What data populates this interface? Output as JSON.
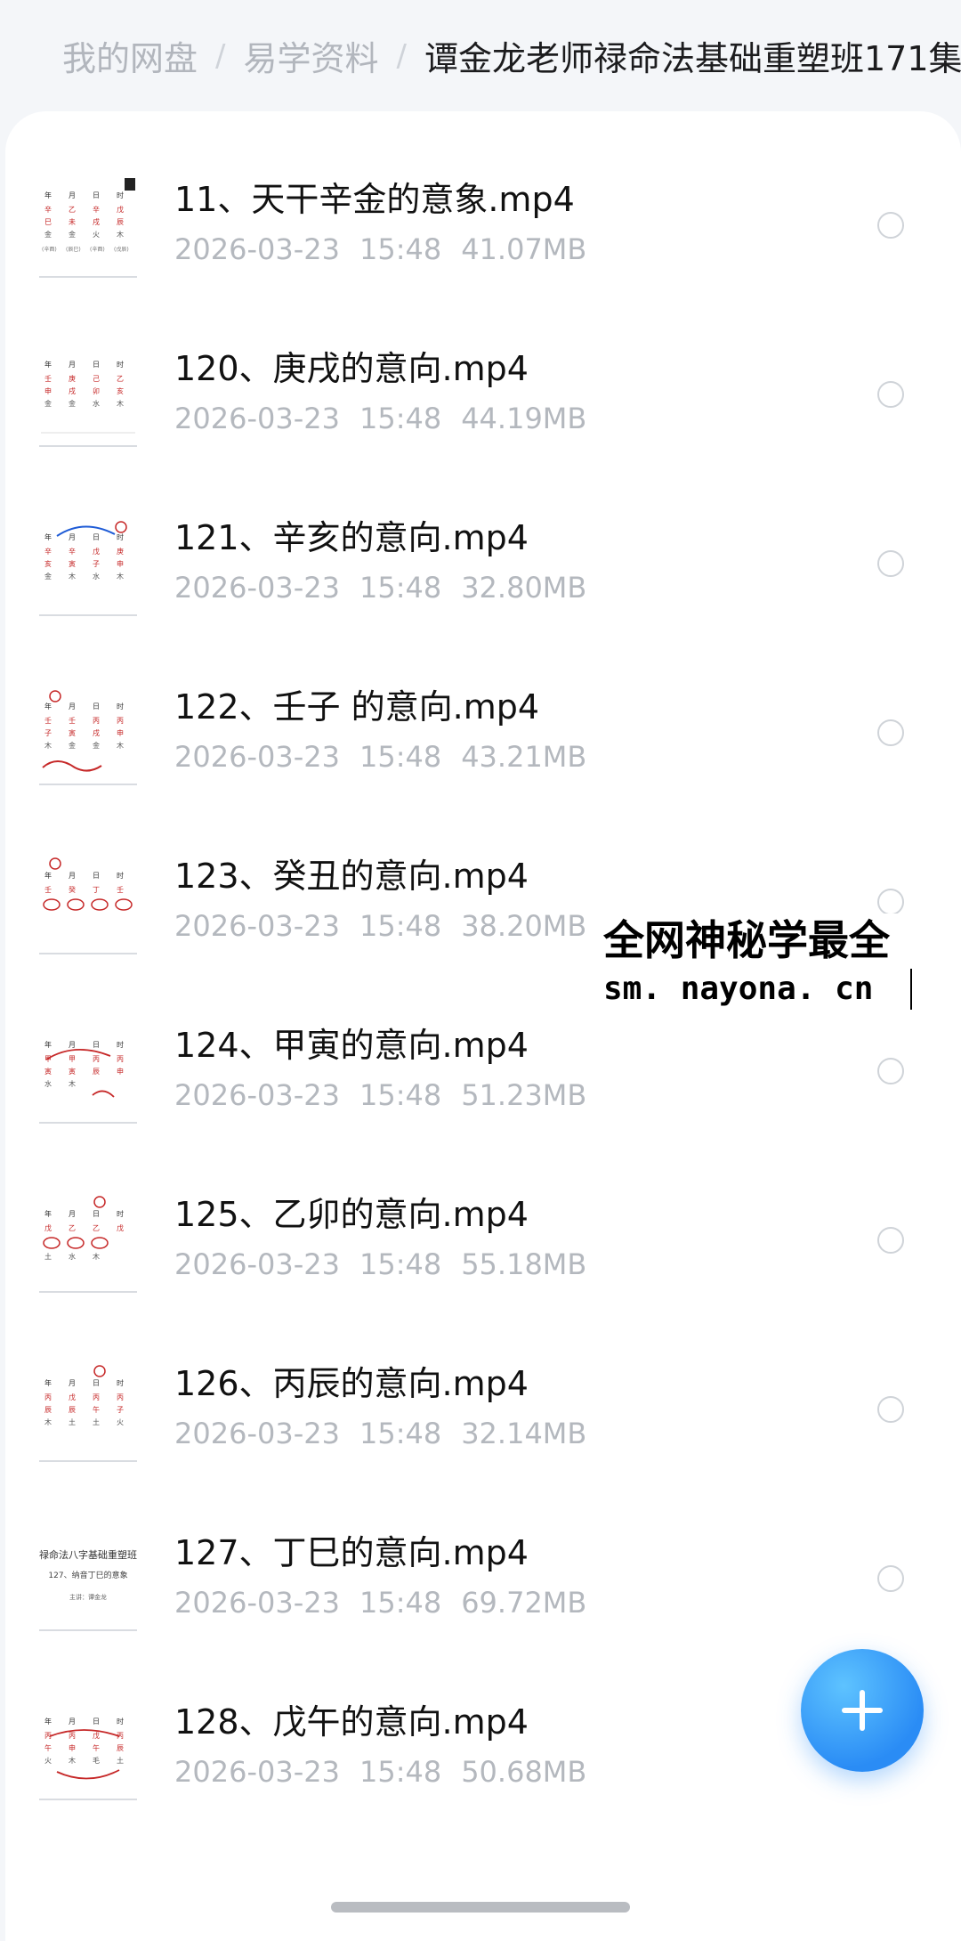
{
  "breadcrumb": {
    "items": [
      "我的网盘",
      "易学资料",
      "谭金龙老师禄命法基础重塑班171集"
    ],
    "separator": "/"
  },
  "files": [
    {
      "name": "11、天干辛金的意象.mp4",
      "date": "2026-03-23",
      "time": "15:48",
      "size": "41.07MB"
    },
    {
      "name": "120、庚戌的意向.mp4",
      "date": "2026-03-23",
      "time": "15:48",
      "size": "44.19MB"
    },
    {
      "name": "121、辛亥的意向.mp4",
      "date": "2026-03-23",
      "time": "15:48",
      "size": "32.80MB"
    },
    {
      "name": "122、壬子 的意向.mp4",
      "date": "2026-03-23",
      "time": "15:48",
      "size": "43.21MB"
    },
    {
      "name": "123、癸丑的意向.mp4",
      "date": "2026-03-23",
      "time": "15:48",
      "size": "38.20MB"
    },
    {
      "name": "124、甲寅的意向.mp4",
      "date": "2026-03-23",
      "time": "15:48",
      "size": "51.23MB"
    },
    {
      "name": "125、乙卯的意向.mp4",
      "date": "2026-03-23",
      "time": "15:48",
      "size": "55.18MB"
    },
    {
      "name": "126、丙辰的意向.mp4",
      "date": "2026-03-23",
      "time": "15:48",
      "size": "32.14MB"
    },
    {
      "name": "127、丁巳的意向.mp4",
      "date": "2026-03-23",
      "time": "15:48",
      "size": "69.72MB"
    },
    {
      "name": "128、戊午的意向.mp4",
      "date": "2026-03-23",
      "time": "15:48",
      "size": "50.68MB"
    }
  ],
  "watermark": {
    "line1": "全网神秘学最全",
    "line2": "sm. nayona. cn"
  },
  "thumbnail": {
    "text_title": "禄命法八字基础重塑班",
    "text_subtitle": "127、纳音丁巳的意象",
    "text_author": "主讲：谭金龙"
  },
  "fab": {
    "icon": "plus-icon"
  },
  "colors": {
    "accent": "#2a8cf5",
    "meta": "#b4b8be",
    "ink": "#c62828"
  }
}
